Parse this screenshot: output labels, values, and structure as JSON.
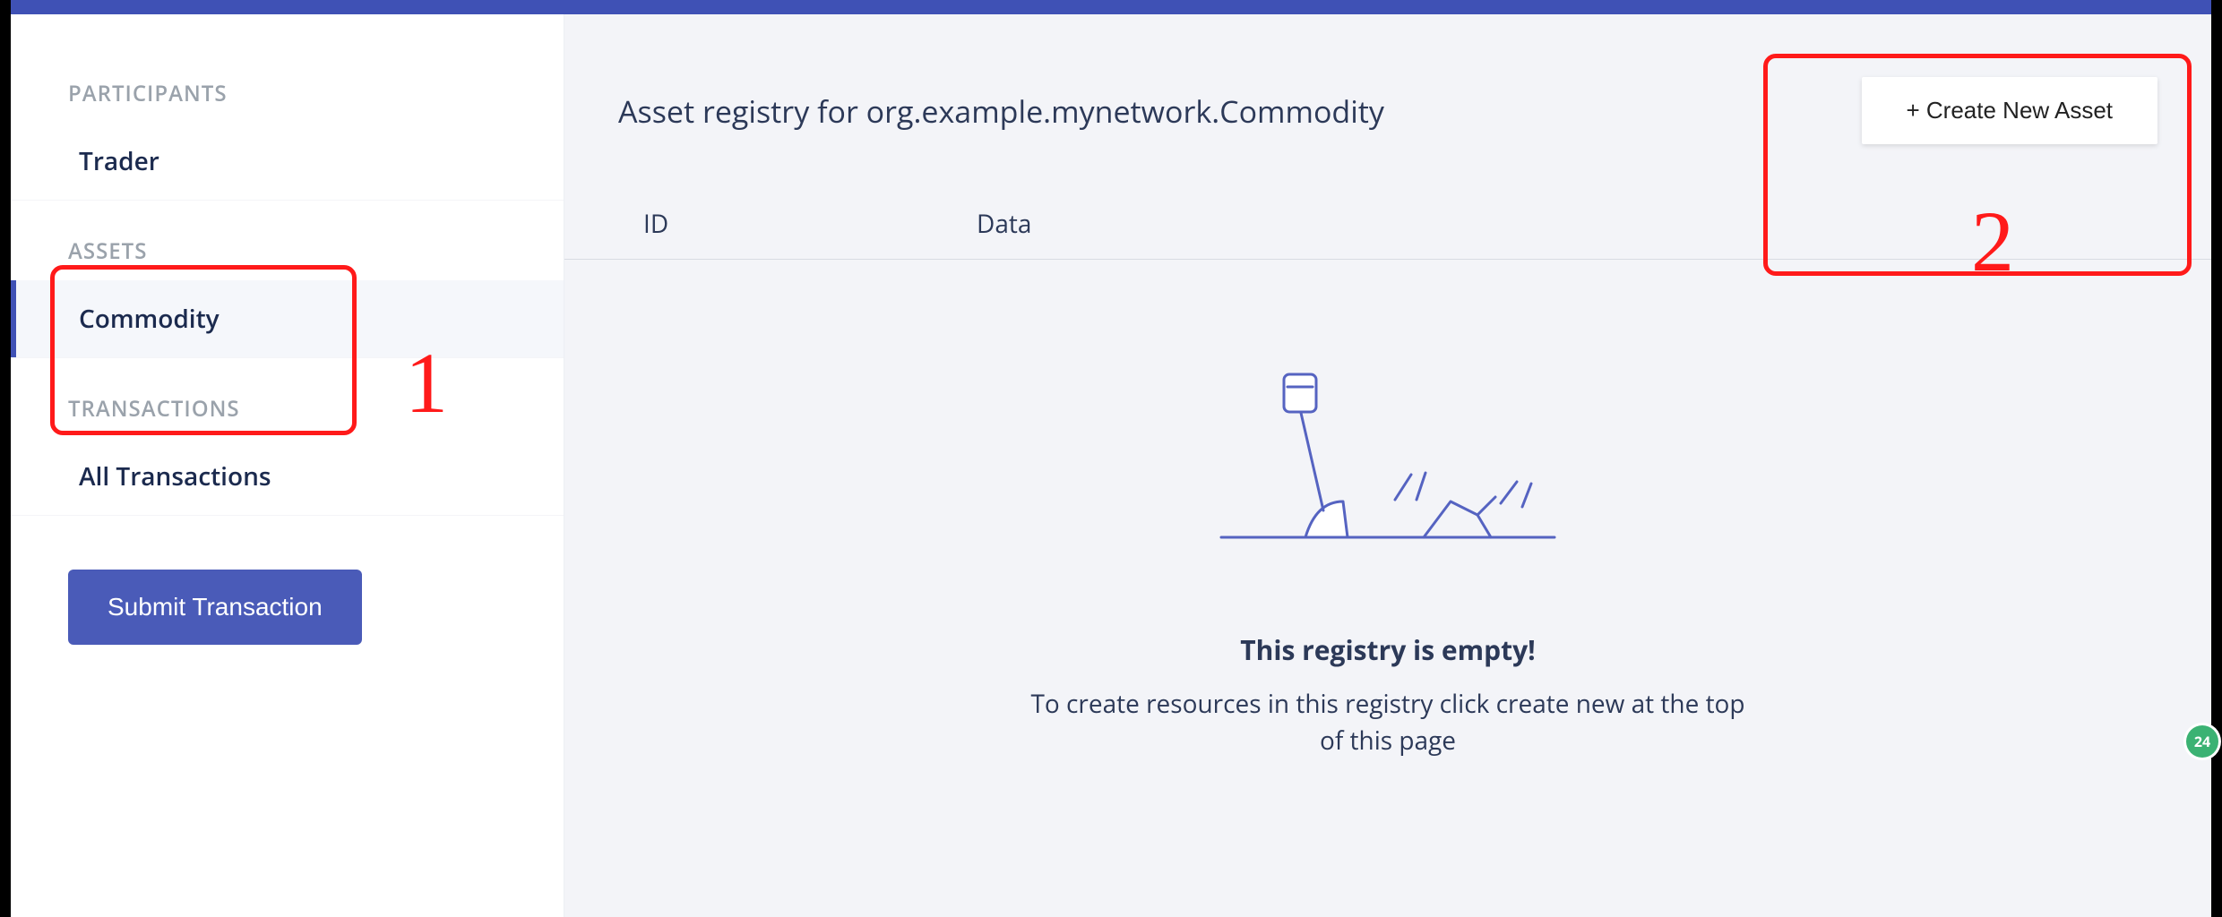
{
  "sidebar": {
    "sections": {
      "participants": {
        "label": "PARTICIPANTS"
      },
      "assets": {
        "label": "ASSETS"
      },
      "transactions": {
        "label": "TRANSACTIONS"
      }
    },
    "items": {
      "trader": {
        "label": "Trader"
      },
      "commodity": {
        "label": "Commodity"
      },
      "all_tx": {
        "label": "All Transactions"
      }
    },
    "submit_label": "Submit Transaction"
  },
  "main": {
    "title": "Asset registry for org.example.mynetwork.Commodity",
    "create_label": "+ Create New Asset",
    "columns": {
      "id": "ID",
      "data": "Data"
    },
    "empty_title": "This registry is empty!",
    "empty_sub": "To create resources in this registry click create new at the top of this page"
  },
  "annotations": {
    "one": "1",
    "two": "2",
    "badge": "24"
  }
}
